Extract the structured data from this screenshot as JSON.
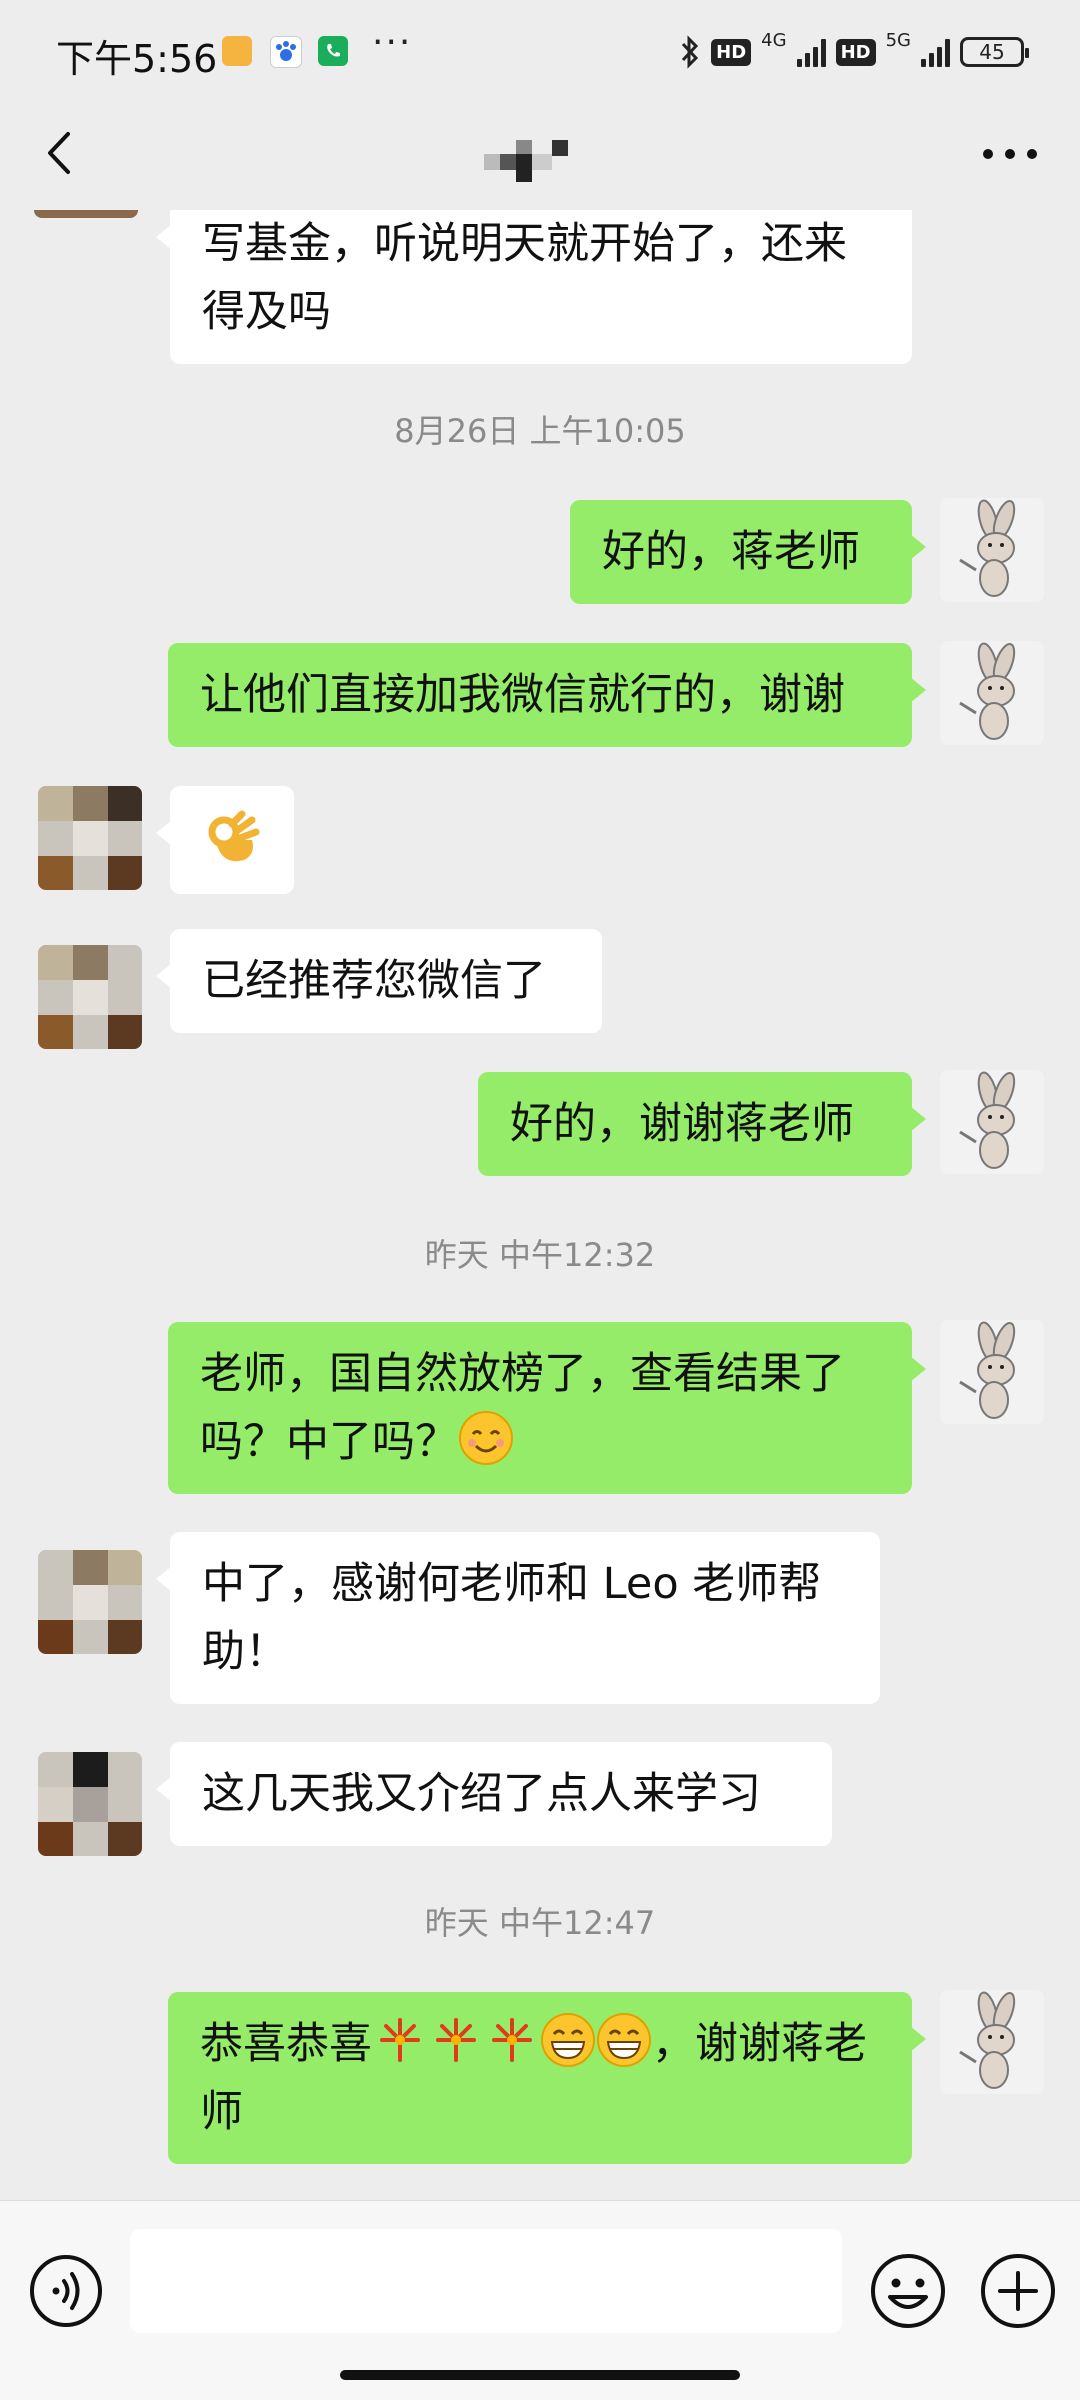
{
  "status_bar": {
    "time": "下午5:56",
    "dots": "···",
    "hd1": "HD",
    "net1": "4G",
    "hd2": "HD",
    "net2": "5G",
    "battery": "45"
  },
  "nav": {
    "back_icon": "chevron-left-icon",
    "more_icon": "more-dots-icon"
  },
  "messages": [
    {
      "side": "other",
      "text": "写基金，听说明天就开始了，还来得及吗"
    },
    {
      "type": "time",
      "text": "8月26日 上午10:05"
    },
    {
      "side": "me",
      "text": "好的，蒋老师"
    },
    {
      "side": "me",
      "text": "让他们直接加我微信就行的，谢谢"
    },
    {
      "side": "other",
      "text": "",
      "emoji": "ok-hand"
    },
    {
      "side": "other",
      "text": "已经推荐您微信了"
    },
    {
      "side": "me",
      "text": "好的，谢谢蒋老师"
    },
    {
      "type": "time",
      "text": "昨天 中午12:32"
    },
    {
      "side": "me",
      "text": "老师，国自然放榜了，查看结果了吗？中了吗？",
      "emoji": "smile"
    },
    {
      "side": "other",
      "text": "中了，感谢何老师和 Leo 老师帮助！"
    },
    {
      "side": "other",
      "text": "这几天我又介绍了点人来学习"
    },
    {
      "type": "time",
      "text": "昨天 中午12:47"
    },
    {
      "side": "me",
      "text_before": "恭喜恭喜",
      "emojis": [
        "firecracker",
        "firecracker",
        "firecracker",
        "grin",
        "grin"
      ],
      "text_after": "，谢谢蒋老师"
    }
  ],
  "input_bar": {
    "placeholder": "",
    "voice_icon": "voice-icon",
    "emoji_icon": "emoji-icon",
    "plus_icon": "plus-icon"
  },
  "colors": {
    "my_bubble": "#95ec69",
    "other_bubble": "#ffffff",
    "background": "#ededed"
  }
}
